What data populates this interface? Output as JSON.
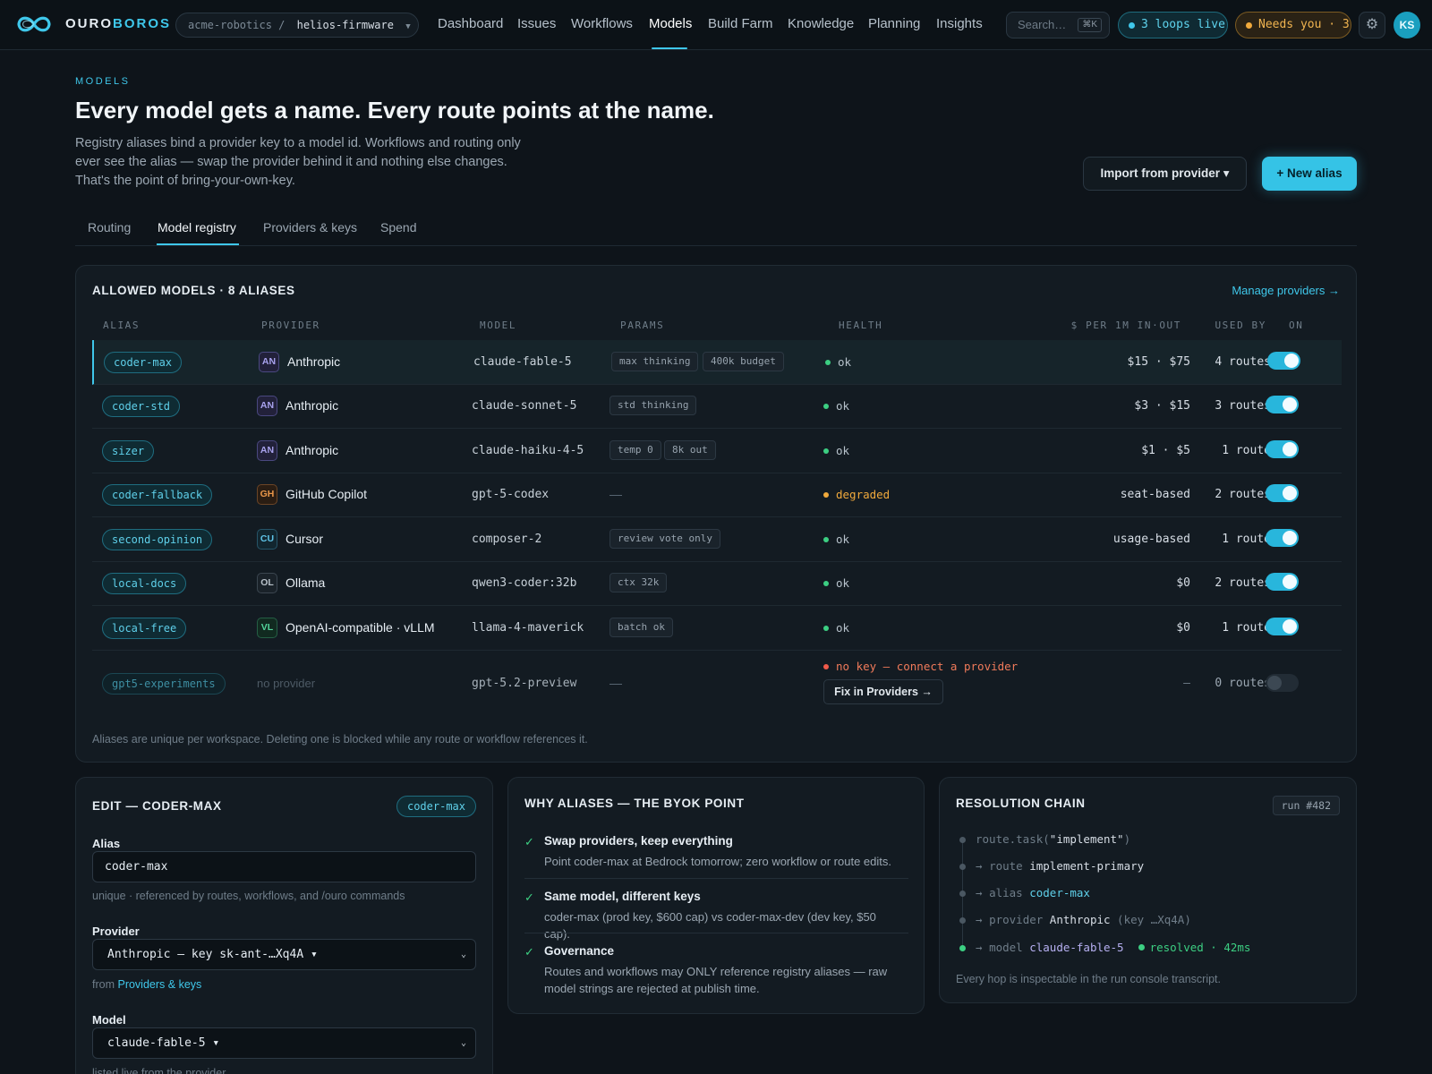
{
  "app": {
    "brand_a": "OURO",
    "brand_b": "BOROS",
    "org": "acme-robotics",
    "repo": "helios-firmware",
    "nav": [
      "Dashboard",
      "Issues",
      "Workflows",
      "Models",
      "Build Farm",
      "Knowledge",
      "Planning",
      "Insights"
    ],
    "active_nav": "Models",
    "search_placeholder": "Search…",
    "search_shortcut": "⌘K",
    "loops_badge": "3 loops live",
    "needs_badge": "Needs you · 3",
    "avatar_initials": "KS"
  },
  "header": {
    "eyebrow": "MODELS",
    "title": "Every model gets a name. Every route points at the name.",
    "lede": "Registry aliases bind a provider key to a model id. Workflows and routing only ever see the alias — swap the provider behind it and nothing else changes. That's the point of bring-your-own-key.",
    "import_button": "Import from provider ▾",
    "new_button": "+ New alias"
  },
  "tabs": [
    "Routing",
    "Model registry",
    "Providers & keys",
    "Spend"
  ],
  "active_tab": "Model registry",
  "registry": {
    "title": "ALLOWED MODELS · 8 ALIASES",
    "manage_link": "Manage providers →",
    "columns": [
      "ALIAS",
      "PROVIDER",
      "MODEL",
      "PARAMS",
      "HEALTH",
      "$ PER 1M IN·OUT",
      "USED BY",
      "ON"
    ],
    "rows": [
      {
        "alias": "coder-max",
        "badge": "AN",
        "provider": "Anthropic",
        "model": "claude-fable-5",
        "params": [
          "max thinking",
          "400k budget"
        ],
        "health": "ok",
        "price": "$15 · $75",
        "used_by": "4 routes",
        "on": true
      },
      {
        "alias": "coder-std",
        "badge": "AN",
        "provider": "Anthropic",
        "model": "claude-sonnet-5",
        "params": [
          "std thinking"
        ],
        "health": "ok",
        "price": "$3 · $15",
        "used_by": "3 routes",
        "on": true
      },
      {
        "alias": "sizer",
        "badge": "AN",
        "provider": "Anthropic",
        "model": "claude-haiku-4-5",
        "params": [
          "temp 0",
          "8k out"
        ],
        "health": "ok",
        "price": "$1 · $5",
        "used_by": "1 route",
        "on": true
      },
      {
        "alias": "coder-fallback",
        "badge": "GH",
        "provider": "GitHub Copilot",
        "model": "gpt-5-codex",
        "params": [],
        "params_empty": "—",
        "health": "degraded",
        "price": "seat-based",
        "used_by": "2 routes",
        "on": true
      },
      {
        "alias": "second-opinion",
        "badge": "CU",
        "provider": "Cursor",
        "model": "composer-2",
        "params": [
          "review vote only"
        ],
        "health": "ok",
        "price": "usage-based",
        "used_by": "1 route",
        "on": true
      },
      {
        "alias": "local-docs",
        "badge": "OL",
        "provider": "Ollama",
        "model": "qwen3-coder:32b",
        "params": [
          "ctx 32k"
        ],
        "health": "ok",
        "price": "$0",
        "used_by": "2 routes",
        "on": true
      },
      {
        "alias": "local-free",
        "badge": "VL",
        "provider": "OpenAI-compatible · vLLM",
        "model": "llama-4-maverick",
        "params": [
          "batch ok"
        ],
        "health": "ok",
        "price": "$0",
        "used_by": "1 route",
        "on": true
      },
      {
        "alias": "gpt5-experiments",
        "badge": "",
        "provider": "no provider",
        "model": "gpt-5.2-preview",
        "params": [],
        "params_empty": "—",
        "health": "no key — connect a provider",
        "fix_button": "Fix in Providers →",
        "price": "—",
        "used_by": "0 routes",
        "on": false
      }
    ],
    "footnote": "Aliases are unique per workspace. Deleting one is blocked while any route or workflow references it."
  },
  "edit": {
    "title": "EDIT — CODER-MAX",
    "badge": "coder-max",
    "alias_label": "Alias",
    "alias_value": "coder-max",
    "alias_hint": "unique · referenced by routes, workflows, and /ouro commands",
    "provider_label": "Provider",
    "provider_value": "Anthropic — key sk-ant-…Xq4A ▾",
    "provider_hint_prefix": "from",
    "provider_hint_link": "Providers & keys",
    "model_label": "Model",
    "model_value": "claude-fable-5 ▾",
    "model_hint": "listed live from the provider"
  },
  "why": {
    "title": "WHY ALIASES — THE BYOK POINT",
    "items": [
      {
        "title": "Swap providers, keep everything",
        "desc": "Point coder-max at Bedrock tomorrow; zero workflow or route edits."
      },
      {
        "title": "Same model, different keys",
        "desc": "coder-max (prod key, $600 cap) vs coder-max-dev (dev key, $50 cap)."
      },
      {
        "title": "Governance",
        "desc": "Routes and workflows may ONLY reference registry aliases — raw model strings are rejected at publish time."
      }
    ]
  },
  "resolution": {
    "title": "RESOLUTION CHAIN",
    "run": "run #482",
    "hops": [
      {
        "prefix": "",
        "key": "route.task(",
        "value": "\"implement\"",
        "suffix": ")"
      },
      {
        "prefix": "→ ",
        "key": "route ",
        "value": "implement-primary",
        "suffix": ""
      },
      {
        "prefix": "→ ",
        "key": "alias ",
        "value": "coder-max",
        "suffix": ""
      },
      {
        "prefix": "→ ",
        "key": "provider ",
        "value": "Anthropic",
        "suffix": " (key …Xq4A)"
      },
      {
        "prefix": "→ ",
        "key": "model ",
        "value": "claude-fable-5",
        "suffix": ""
      }
    ],
    "resolved": "resolved · 42ms",
    "footnote": "Every hop is inspectable in the run console transcript."
  },
  "colors": {
    "accent": "#3fc7ea",
    "ok": "#3ccf82",
    "warn": "#f0a93c",
    "error": "#f05a4a",
    "background": "#0e141a"
  },
  "icons": [
    "ouroboros-logo-icon",
    "search-icon",
    "gear-icon",
    "check-icon",
    "chevron-down-icon"
  ]
}
